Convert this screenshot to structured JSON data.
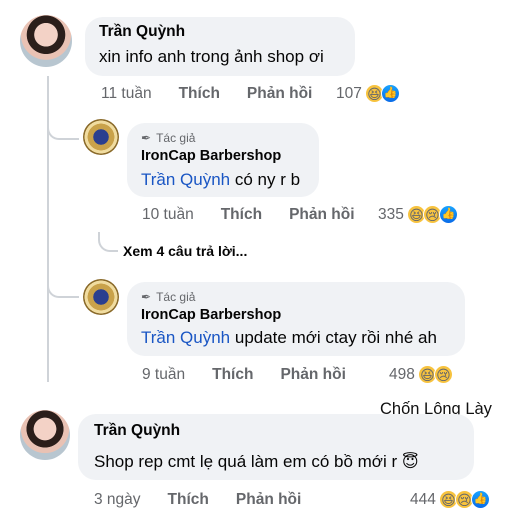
{
  "comments": [
    {
      "author": "Trần Quỳnh",
      "text": "xin info anh trong ảnh shop ơi",
      "time": "11 tuần",
      "like": "Thích",
      "reply": "Phản hồi",
      "reactions": "107"
    },
    {
      "author_badge": "Tác giả",
      "author": "IronCap Barbershop",
      "mention": "Trần Quỳnh",
      "text": " có ny r b",
      "time": "10 tuần",
      "like": "Thích",
      "reply": "Phản hồi",
      "reactions": "335"
    },
    {
      "see_more": "Xem 4 câu trả lời..."
    },
    {
      "author_badge": "Tác giả",
      "author": "IronCap Barbershop",
      "mention": "Trần Quỳnh",
      "text": " update mới ctay rồi nhé ah",
      "time": "9 tuần",
      "like": "Thích",
      "reply": "Phản hồi",
      "reactions": "498"
    },
    {
      "author": "Trần Quỳnh",
      "text": "Shop rep cmt lẹ quá làm em có bồ mới r",
      "time": "3 ngày",
      "like": "Thích",
      "reply": "Phản hồi",
      "reactions": "444"
    }
  ],
  "watermark": "Chốn Lông Lày",
  "icons": {
    "haha": "haha-reaction-icon",
    "sad": "sad-reaction-icon",
    "like": "like-reaction-icon",
    "angel": "angel-emoji-icon",
    "pen": "pen-icon"
  }
}
